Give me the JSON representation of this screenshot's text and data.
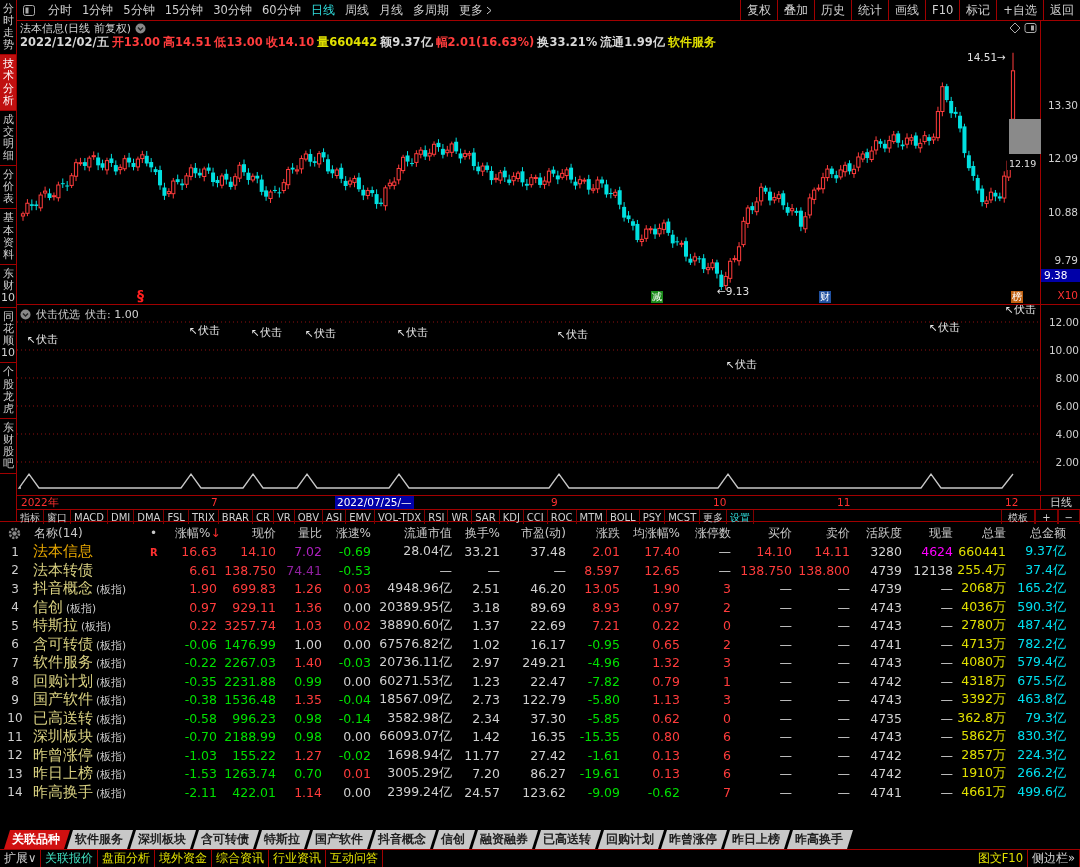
{
  "sidebar": [
    {
      "label": "分时走势",
      "selected": false
    },
    {
      "label": "技术分析",
      "selected": true
    },
    {
      "label": "成交明细",
      "selected": false
    },
    {
      "label": "分价表",
      "selected": false
    },
    {
      "label": "基本资料",
      "selected": false
    },
    {
      "label": "东财10",
      "selected": false
    },
    {
      "label": "同花顺10",
      "selected": false
    },
    {
      "label": "个股龙虎",
      "selected": false
    },
    {
      "label": "东财股吧",
      "selected": false
    }
  ],
  "periods": [
    {
      "label": "分时",
      "selected": false
    },
    {
      "label": "1分钟",
      "selected": false
    },
    {
      "label": "5分钟",
      "selected": false
    },
    {
      "label": "15分钟",
      "selected": false
    },
    {
      "label": "30分钟",
      "selected": false
    },
    {
      "label": "60分钟",
      "selected": false
    },
    {
      "label": "日线",
      "selected": true
    },
    {
      "label": "周线",
      "selected": false
    },
    {
      "label": "月线",
      "selected": false
    },
    {
      "label": "多周期",
      "selected": false
    },
    {
      "label": "更多",
      "selected": false
    }
  ],
  "toolbar": [
    "复权",
    "叠加",
    "历史",
    "统计",
    "画线",
    "F10",
    "标记",
    "+自选",
    "返回"
  ],
  "chart": {
    "title": "法本信息(日线 前复权)",
    "info": [
      {
        "text": "2022/12/02/五",
        "color": "#d8d8d8"
      },
      {
        "text": "开13.00",
        "color": "#ff3c3c"
      },
      {
        "text": "高14.51",
        "color": "#ff3c3c"
      },
      {
        "text": "低13.00",
        "color": "#ff3c3c"
      },
      {
        "text": "收14.10",
        "color": "#ff3c3c"
      },
      {
        "text": "量660442",
        "color": "#e0e000"
      },
      {
        "text": "额9.37亿",
        "color": "#d8d8d8"
      },
      {
        "text": "幅2.01(16.63%)",
        "color": "#ff3c3c"
      },
      {
        "text": "换33.21%",
        "color": "#d8d8d8"
      },
      {
        "text": "流通1.99亿",
        "color": "#d8d8d8"
      },
      {
        "text": "软件服务",
        "color": "#e0e000"
      }
    ],
    "yticks": [
      "13.30",
      "12.09",
      "10.88",
      "9.79"
    ],
    "cursor_price": "9.38",
    "high_label": "14.51→",
    "last_label": "12.19",
    "low_label": "←9.13",
    "markers": [
      {
        "text": "§",
        "kind": "plain",
        "color": "#ff2020"
      },
      {
        "text": "减",
        "kind": "tag",
        "color": "#1a8a1a"
      },
      {
        "text": "财",
        "kind": "tag",
        "color": "#2050a0"
      },
      {
        "text": "榜",
        "kind": "tag",
        "color": "#c06010"
      }
    ],
    "zoom_label": "X10"
  },
  "indicator": {
    "title": "伏击优选",
    "value": "伏击: 1.00",
    "yticks": [
      "12.00",
      "10.00",
      "8.00",
      "6.00",
      "4.00",
      "2.00"
    ],
    "signals": [
      "↖伏击",
      "↖伏击",
      "↖伏击",
      "↖伏击",
      "↖伏击",
      "↖伏击",
      "↖伏击",
      "↖伏击",
      "↖伏击"
    ]
  },
  "dates": [
    {
      "text": "2022年",
      "kind": "tick"
    },
    {
      "text": "7",
      "kind": "tick"
    },
    {
      "text": "2022/07/25/—",
      "kind": "cursor"
    },
    {
      "text": "9",
      "kind": "tick"
    },
    {
      "text": "10",
      "kind": "tick"
    },
    {
      "text": "11",
      "kind": "tick"
    },
    {
      "text": "12",
      "kind": "tick"
    }
  ],
  "period_label": "日线",
  "indicator_tabs": [
    {
      "label": "指标",
      "kind": "menu"
    },
    {
      "label": "窗口",
      "kind": "menu"
    },
    {
      "label": "MACD",
      "kind": "indicator"
    },
    {
      "label": "DMI",
      "kind": "indicator"
    },
    {
      "label": "DMA",
      "kind": "indicator"
    },
    {
      "label": "FSL",
      "kind": "indicator"
    },
    {
      "label": "TRIX",
      "kind": "indicator"
    },
    {
      "label": "BRAR",
      "kind": "indicator"
    },
    {
      "label": "CR",
      "kind": "indicator"
    },
    {
      "label": "VR",
      "kind": "indicator"
    },
    {
      "label": "OBV",
      "kind": "indicator"
    },
    {
      "label": "ASI",
      "kind": "indicator"
    },
    {
      "label": "EMV",
      "kind": "indicator"
    },
    {
      "label": "VOL-TDX",
      "kind": "indicator"
    },
    {
      "label": "RSI",
      "kind": "indicator"
    },
    {
      "label": "WR",
      "kind": "indicator"
    },
    {
      "label": "SAR",
      "kind": "indicator"
    },
    {
      "label": "KDJ",
      "kind": "indicator"
    },
    {
      "label": "CCI",
      "kind": "indicator"
    },
    {
      "label": "ROC",
      "kind": "indicator"
    },
    {
      "label": "MTM",
      "kind": "indicator"
    },
    {
      "label": "BOLL",
      "kind": "indicator"
    },
    {
      "label": "PSY",
      "kind": "indicator"
    },
    {
      "label": "MCST",
      "kind": "indicator"
    },
    {
      "label": "更多",
      "kind": "menu"
    },
    {
      "label": "设置",
      "kind": "action"
    }
  ],
  "panel_buttons": [
    "模板",
    "+",
    "−"
  ],
  "table": {
    "name_header": "名称(14)",
    "mark_header": "•",
    "columns": [
      {
        "label": "涨幅%",
        "sort": "↓"
      },
      {
        "label": "现价"
      },
      {
        "label": "量比"
      },
      {
        "label": "涨速%"
      },
      {
        "label": "流通市值"
      },
      {
        "label": "换手%"
      },
      {
        "label": "市盈(动)"
      },
      {
        "label": "涨跌"
      },
      {
        "label": "均涨幅%"
      },
      {
        "label": "涨停数"
      },
      {
        "label": "买价"
      },
      {
        "label": "卖价"
      },
      {
        "label": "活跃度"
      },
      {
        "label": "现量"
      },
      {
        "label": "总量"
      },
      {
        "label": "总金额"
      }
    ],
    "rows": [
      {
        "no": "1",
        "name": "法本信息",
        "color": "#e8a800",
        "mark": "R",
        "cells": [
          {
            "text": "16.63",
            "color": "#ff3c3c"
          },
          {
            "text": "14.10",
            "color": "#ff3c3c"
          },
          {
            "text": "7.02",
            "color": "#b020c0"
          },
          {
            "text": "-0.69",
            "color": "#00e000"
          },
          {
            "text": "28.04亿",
            "color": "#d0d0d0"
          },
          {
            "text": "33.21",
            "color": "#d0d0d0"
          },
          {
            "text": "37.48",
            "color": "#d0d0d0"
          },
          {
            "text": "2.01",
            "color": "#ff3c3c"
          },
          {
            "text": "17.40",
            "color": "#ff3c3c"
          },
          {
            "text": "—"
          },
          {
            "text": "14.10",
            "color": "#ff3c3c"
          },
          {
            "text": "14.11",
            "color": "#ff3c3c"
          },
          {
            "text": "3280",
            "color": "#d0d0d0"
          },
          {
            "text": "4624",
            "color": "#ff00ff"
          },
          {
            "text": "660441",
            "color": "#e0e000"
          },
          {
            "text": "9.37亿",
            "color": "#00e0f0"
          }
        ]
      },
      {
        "no": "2",
        "name": "法本转债",
        "color": "#d8d080",
        "cells": [
          {
            "text": "6.61",
            "color": "#ff3c3c"
          },
          {
            "text": "138.750",
            "color": "#ff3c3c"
          },
          {
            "text": "74.41",
            "color": "#9020a0"
          },
          {
            "text": "-0.53",
            "color": "#00e000"
          },
          {
            "text": "—"
          },
          {
            "text": "—"
          },
          {
            "text": "—"
          },
          {
            "text": "8.597",
            "color": "#ff3c3c"
          },
          {
            "text": "12.65",
            "color": "#ff3c3c"
          },
          {
            "text": "—"
          },
          {
            "text": "138.750",
            "color": "#ff3c3c"
          },
          {
            "text": "138.800",
            "color": "#ff3c3c"
          },
          {
            "text": "4739",
            "color": "#d0d0d0"
          },
          {
            "text": "12138",
            "color": "#d0d0d0"
          },
          {
            "text": "255.4万",
            "color": "#e0e000"
          },
          {
            "text": "37.4亿",
            "color": "#00e0f0"
          }
        ]
      },
      {
        "no": "3",
        "name": "抖音概念",
        "tag": "(板指)",
        "color": "#d8d080",
        "cells": [
          {
            "text": "1.90",
            "color": "#ff3c3c"
          },
          {
            "text": "699.83",
            "color": "#ff3c3c"
          },
          {
            "text": "1.26",
            "color": "#ff3c3c"
          },
          {
            "text": "0.03",
            "color": "#ff3c3c"
          },
          {
            "text": "4948.96亿",
            "color": "#d0d0d0"
          },
          {
            "text": "2.51",
            "color": "#d0d0d0"
          },
          {
            "text": "46.20",
            "color": "#d0d0d0"
          },
          {
            "text": "13.05",
            "color": "#ff3c3c"
          },
          {
            "text": "1.90",
            "color": "#ff3c3c"
          },
          {
            "text": "3",
            "color": "#ff3c3c"
          },
          {
            "text": "—"
          },
          {
            "text": "—"
          },
          {
            "text": "4739",
            "color": "#d0d0d0"
          },
          {
            "text": "—"
          },
          {
            "text": "2068万",
            "color": "#e0e000"
          },
          {
            "text": "165.2亿",
            "color": "#00e0f0"
          }
        ]
      },
      {
        "no": "4",
        "name": "信创",
        "tag": "(板指)",
        "color": "#d8d080",
        "cells": [
          {
            "text": "0.97",
            "color": "#ff3c3c"
          },
          {
            "text": "929.11",
            "color": "#ff3c3c"
          },
          {
            "text": "1.36",
            "color": "#ff3c3c"
          },
          {
            "text": "0.00",
            "color": "#d0d0d0"
          },
          {
            "text": "20389.95亿",
            "color": "#d0d0d0"
          },
          {
            "text": "3.18",
            "color": "#d0d0d0"
          },
          {
            "text": "89.69",
            "color": "#d0d0d0"
          },
          {
            "text": "8.93",
            "color": "#ff3c3c"
          },
          {
            "text": "0.97",
            "color": "#ff3c3c"
          },
          {
            "text": "2",
            "color": "#ff3c3c"
          },
          {
            "text": "—"
          },
          {
            "text": "—"
          },
          {
            "text": "4743",
            "color": "#d0d0d0"
          },
          {
            "text": "—"
          },
          {
            "text": "4036万",
            "color": "#e0e000"
          },
          {
            "text": "590.3亿",
            "color": "#00e0f0"
          }
        ]
      },
      {
        "no": "5",
        "name": "特斯拉",
        "tag": "(板指)",
        "color": "#d8d080",
        "cells": [
          {
            "text": "0.22",
            "color": "#ff3c3c"
          },
          {
            "text": "3257.74",
            "color": "#ff3c3c"
          },
          {
            "text": "1.03",
            "color": "#ff3c3c"
          },
          {
            "text": "0.02",
            "color": "#ff3c3c"
          },
          {
            "text": "38890.60亿",
            "color": "#d0d0d0"
          },
          {
            "text": "1.37",
            "color": "#d0d0d0"
          },
          {
            "text": "22.69",
            "color": "#d0d0d0"
          },
          {
            "text": "7.21",
            "color": "#ff3c3c"
          },
          {
            "text": "0.22",
            "color": "#ff3c3c"
          },
          {
            "text": "0",
            "color": "#ff3c3c"
          },
          {
            "text": "—"
          },
          {
            "text": "—"
          },
          {
            "text": "4743",
            "color": "#d0d0d0"
          },
          {
            "text": "—"
          },
          {
            "text": "2780万",
            "color": "#e0e000"
          },
          {
            "text": "487.4亿",
            "color": "#00e0f0"
          }
        ]
      },
      {
        "no": "6",
        "name": "含可转债",
        "tag": "(板指)",
        "color": "#d8d080",
        "cells": [
          {
            "text": "-0.06",
            "color": "#00e000"
          },
          {
            "text": "1476.99",
            "color": "#00e000"
          },
          {
            "text": "1.00",
            "color": "#d0d0d0"
          },
          {
            "text": "0.00",
            "color": "#d0d0d0"
          },
          {
            "text": "67576.82亿",
            "color": "#d0d0d0"
          },
          {
            "text": "1.02",
            "color": "#d0d0d0"
          },
          {
            "text": "16.17",
            "color": "#d0d0d0"
          },
          {
            "text": "-0.95",
            "color": "#00e000"
          },
          {
            "text": "0.65",
            "color": "#ff3c3c"
          },
          {
            "text": "2",
            "color": "#ff3c3c"
          },
          {
            "text": "—"
          },
          {
            "text": "—"
          },
          {
            "text": "4741",
            "color": "#d0d0d0"
          },
          {
            "text": "—"
          },
          {
            "text": "4713万",
            "color": "#e0e000"
          },
          {
            "text": "782.2亿",
            "color": "#00e0f0"
          }
        ]
      },
      {
        "no": "7",
        "name": "软件服务",
        "tag": "(板指)",
        "color": "#d8d080",
        "cells": [
          {
            "text": "-0.22",
            "color": "#00e000"
          },
          {
            "text": "2267.03",
            "color": "#00e000"
          },
          {
            "text": "1.40",
            "color": "#ff3c3c"
          },
          {
            "text": "-0.03",
            "color": "#00e000"
          },
          {
            "text": "20736.11亿",
            "color": "#d0d0d0"
          },
          {
            "text": "2.97",
            "color": "#d0d0d0"
          },
          {
            "text": "249.21",
            "color": "#d0d0d0"
          },
          {
            "text": "-4.96",
            "color": "#00e000"
          },
          {
            "text": "1.32",
            "color": "#ff3c3c"
          },
          {
            "text": "3",
            "color": "#ff3c3c"
          },
          {
            "text": "—"
          },
          {
            "text": "—"
          },
          {
            "text": "4743",
            "color": "#d0d0d0"
          },
          {
            "text": "—"
          },
          {
            "text": "4080万",
            "color": "#e0e000"
          },
          {
            "text": "579.4亿",
            "color": "#00e0f0"
          }
        ]
      },
      {
        "no": "8",
        "name": "回购计划",
        "tag": "(板指)",
        "color": "#d8d080",
        "cells": [
          {
            "text": "-0.35",
            "color": "#00e000"
          },
          {
            "text": "2231.88",
            "color": "#00e000"
          },
          {
            "text": "0.99",
            "color": "#00e000"
          },
          {
            "text": "0.00",
            "color": "#d0d0d0"
          },
          {
            "text": "60271.53亿",
            "color": "#d0d0d0"
          },
          {
            "text": "1.23",
            "color": "#d0d0d0"
          },
          {
            "text": "22.47",
            "color": "#d0d0d0"
          },
          {
            "text": "-7.82",
            "color": "#00e000"
          },
          {
            "text": "0.79",
            "color": "#ff3c3c"
          },
          {
            "text": "1",
            "color": "#ff3c3c"
          },
          {
            "text": "—"
          },
          {
            "text": "—"
          },
          {
            "text": "4742",
            "color": "#d0d0d0"
          },
          {
            "text": "—"
          },
          {
            "text": "4318万",
            "color": "#e0e000"
          },
          {
            "text": "675.5亿",
            "color": "#00e0f0"
          }
        ]
      },
      {
        "no": "9",
        "name": "国产软件",
        "tag": "(板指)",
        "color": "#d8d080",
        "cells": [
          {
            "text": "-0.38",
            "color": "#00e000"
          },
          {
            "text": "1536.48",
            "color": "#00e000"
          },
          {
            "text": "1.35",
            "color": "#ff3c3c"
          },
          {
            "text": "-0.04",
            "color": "#00e000"
          },
          {
            "text": "18567.09亿",
            "color": "#d0d0d0"
          },
          {
            "text": "2.73",
            "color": "#d0d0d0"
          },
          {
            "text": "122.79",
            "color": "#d0d0d0"
          },
          {
            "text": "-5.80",
            "color": "#00e000"
          },
          {
            "text": "1.13",
            "color": "#ff3c3c"
          },
          {
            "text": "3",
            "color": "#ff3c3c"
          },
          {
            "text": "—"
          },
          {
            "text": "—"
          },
          {
            "text": "4743",
            "color": "#d0d0d0"
          },
          {
            "text": "—"
          },
          {
            "text": "3392万",
            "color": "#e0e000"
          },
          {
            "text": "463.8亿",
            "color": "#00e0f0"
          }
        ]
      },
      {
        "no": "10",
        "name": "已高送转",
        "tag": "(板指)",
        "color": "#d8d080",
        "cells": [
          {
            "text": "-0.58",
            "color": "#00e000"
          },
          {
            "text": "996.23",
            "color": "#00e000"
          },
          {
            "text": "0.98",
            "color": "#00e000"
          },
          {
            "text": "-0.14",
            "color": "#00e000"
          },
          {
            "text": "3582.98亿",
            "color": "#d0d0d0"
          },
          {
            "text": "2.34",
            "color": "#d0d0d0"
          },
          {
            "text": "37.30",
            "color": "#d0d0d0"
          },
          {
            "text": "-5.85",
            "color": "#00e000"
          },
          {
            "text": "0.62",
            "color": "#ff3c3c"
          },
          {
            "text": "0",
            "color": "#ff3c3c"
          },
          {
            "text": "—"
          },
          {
            "text": "—"
          },
          {
            "text": "4735",
            "color": "#d0d0d0"
          },
          {
            "text": "—"
          },
          {
            "text": "362.8万",
            "color": "#e0e000"
          },
          {
            "text": "79.3亿",
            "color": "#00e0f0"
          }
        ]
      },
      {
        "no": "11",
        "name": "深圳板块",
        "tag": "(板指)",
        "color": "#d8d080",
        "cells": [
          {
            "text": "-0.70",
            "color": "#00e000"
          },
          {
            "text": "2188.99",
            "color": "#00e000"
          },
          {
            "text": "0.98",
            "color": "#00e000"
          },
          {
            "text": "0.00",
            "color": "#d0d0d0"
          },
          {
            "text": "66093.07亿",
            "color": "#d0d0d0"
          },
          {
            "text": "1.42",
            "color": "#d0d0d0"
          },
          {
            "text": "16.35",
            "color": "#d0d0d0"
          },
          {
            "text": "-15.35",
            "color": "#00e000"
          },
          {
            "text": "0.80",
            "color": "#ff3c3c"
          },
          {
            "text": "6",
            "color": "#ff3c3c"
          },
          {
            "text": "—"
          },
          {
            "text": "—"
          },
          {
            "text": "4743",
            "color": "#d0d0d0"
          },
          {
            "text": "—"
          },
          {
            "text": "5862万",
            "color": "#e0e000"
          },
          {
            "text": "830.3亿",
            "color": "#00e0f0"
          }
        ]
      },
      {
        "no": "12",
        "name": "昨曾涨停",
        "tag": "(板指)",
        "color": "#d8d080",
        "cells": [
          {
            "text": "-1.03",
            "color": "#00e000"
          },
          {
            "text": "155.22",
            "color": "#00e000"
          },
          {
            "text": "1.27",
            "color": "#ff3c3c"
          },
          {
            "text": "-0.02",
            "color": "#00e000"
          },
          {
            "text": "1698.94亿",
            "color": "#d0d0d0"
          },
          {
            "text": "11.77",
            "color": "#d0d0d0"
          },
          {
            "text": "27.42",
            "color": "#d0d0d0"
          },
          {
            "text": "-1.61",
            "color": "#00e000"
          },
          {
            "text": "0.13",
            "color": "#ff3c3c"
          },
          {
            "text": "6",
            "color": "#ff3c3c"
          },
          {
            "text": "—"
          },
          {
            "text": "—"
          },
          {
            "text": "4742",
            "color": "#d0d0d0"
          },
          {
            "text": "—"
          },
          {
            "text": "2857万",
            "color": "#e0e000"
          },
          {
            "text": "224.3亿",
            "color": "#00e0f0"
          }
        ]
      },
      {
        "no": "13",
        "name": "昨日上榜",
        "tag": "(板指)",
        "color": "#d8d080",
        "cells": [
          {
            "text": "-1.53",
            "color": "#00e000"
          },
          {
            "text": "1263.74",
            "color": "#00e000"
          },
          {
            "text": "0.70",
            "color": "#00e000"
          },
          {
            "text": "0.01",
            "color": "#ff3c3c"
          },
          {
            "text": "3005.29亿",
            "color": "#d0d0d0"
          },
          {
            "text": "7.20",
            "color": "#d0d0d0"
          },
          {
            "text": "86.27",
            "color": "#d0d0d0"
          },
          {
            "text": "-19.61",
            "color": "#00e000"
          },
          {
            "text": "0.13",
            "color": "#ff3c3c"
          },
          {
            "text": "6",
            "color": "#ff3c3c"
          },
          {
            "text": "—"
          },
          {
            "text": "—"
          },
          {
            "text": "4742",
            "color": "#d0d0d0"
          },
          {
            "text": "—"
          },
          {
            "text": "1910万",
            "color": "#e0e000"
          },
          {
            "text": "266.2亿",
            "color": "#00e0f0"
          }
        ]
      },
      {
        "no": "14",
        "name": "昨高换手",
        "tag": "(板指)",
        "color": "#d8d080",
        "cells": [
          {
            "text": "-2.11",
            "color": "#00e000"
          },
          {
            "text": "422.01",
            "color": "#00e000"
          },
          {
            "text": "1.14",
            "color": "#ff3c3c"
          },
          {
            "text": "0.00",
            "color": "#d0d0d0"
          },
          {
            "text": "2399.24亿",
            "color": "#d0d0d0"
          },
          {
            "text": "24.57",
            "color": "#d0d0d0"
          },
          {
            "text": "123.62",
            "color": "#d0d0d0"
          },
          {
            "text": "-9.09",
            "color": "#00e000"
          },
          {
            "text": "-0.62",
            "color": "#00e000"
          },
          {
            "text": "7",
            "color": "#ff3c3c"
          },
          {
            "text": "—"
          },
          {
            "text": "—"
          },
          {
            "text": "4741",
            "color": "#d0d0d0"
          },
          {
            "text": "—"
          },
          {
            "text": "4661万",
            "color": "#e0e000"
          },
          {
            "text": "499.6亿",
            "color": "#00e0f0"
          }
        ]
      }
    ]
  },
  "bottom_tabs": [
    {
      "label": "关联品种",
      "selected": true
    },
    {
      "label": "软件服务",
      "selected": false
    },
    {
      "label": "深圳板块",
      "selected": false
    },
    {
      "label": "含可转债",
      "selected": false
    },
    {
      "label": "特斯拉",
      "selected": false
    },
    {
      "label": "国产软件",
      "selected": false
    },
    {
      "label": "抖音概念",
      "selected": false
    },
    {
      "label": "信创",
      "selected": false
    },
    {
      "label": "融资融券",
      "selected": false
    },
    {
      "label": "已高送转",
      "selected": false
    },
    {
      "label": "回购计划",
      "selected": false
    },
    {
      "label": "昨曾涨停",
      "selected": false
    },
    {
      "label": "昨日上榜",
      "selected": false
    },
    {
      "label": "昨高换手",
      "selected": false
    }
  ],
  "bottom_bar": {
    "expand": "扩展∨",
    "items": [
      {
        "label": "关联报价",
        "selected": true
      },
      {
        "label": "盘面分析",
        "selected": false
      },
      {
        "label": "境外资金",
        "selected": false
      },
      {
        "label": "综合资讯",
        "selected": false
      },
      {
        "label": "行业资讯",
        "selected": false
      },
      {
        "label": "互动问答",
        "selected": false
      }
    ],
    "right": [
      "图文F10",
      "侧边栏»"
    ]
  }
}
